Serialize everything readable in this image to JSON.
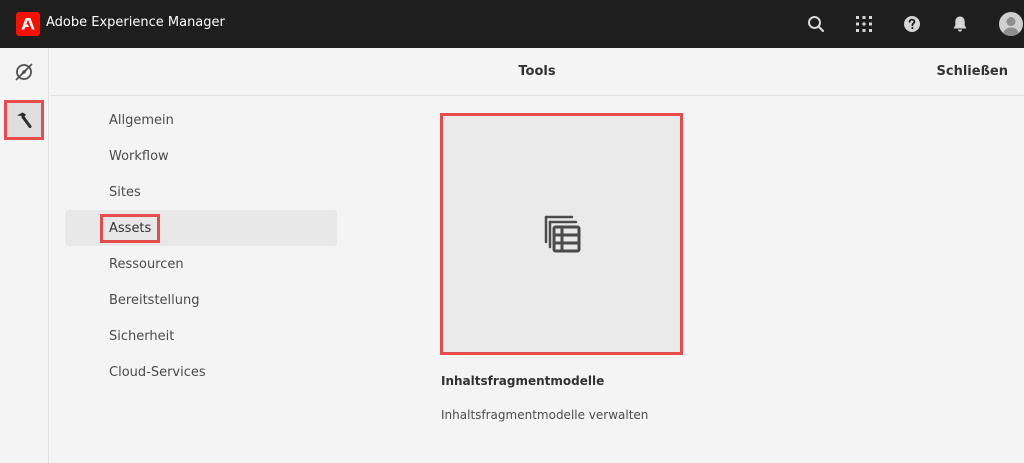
{
  "app": {
    "title": "Adobe Experience Manager",
    "icons": [
      "adobe-logo",
      "search-icon",
      "apps-grid-icon",
      "help-icon",
      "bell-icon",
      "user-avatar"
    ]
  },
  "rail": {
    "items": [
      {
        "name": "navigation-compass-icon",
        "selected": false
      },
      {
        "name": "tools-hammer-icon",
        "selected": true
      }
    ]
  },
  "header": {
    "title": "Tools",
    "close_label": "Schließen"
  },
  "nav": {
    "items": [
      {
        "label": "Allgemein"
      },
      {
        "label": "Workflow"
      },
      {
        "label": "Sites"
      },
      {
        "label": "Assets",
        "active": true
      },
      {
        "label": "Ressourcen"
      },
      {
        "label": "Bereitstellung"
      },
      {
        "label": "Sicherheit"
      },
      {
        "label": "Cloud-Services"
      }
    ]
  },
  "card": {
    "icon": "content-fragment-model-icon",
    "title": "Inhaltsfragmentmodelle",
    "description": "Inhaltsfragmentmodelle verwalten"
  },
  "colors": {
    "topbar": "#1e1e1e",
    "highlight": "#e64c4c",
    "brand": "#fa0f00"
  }
}
